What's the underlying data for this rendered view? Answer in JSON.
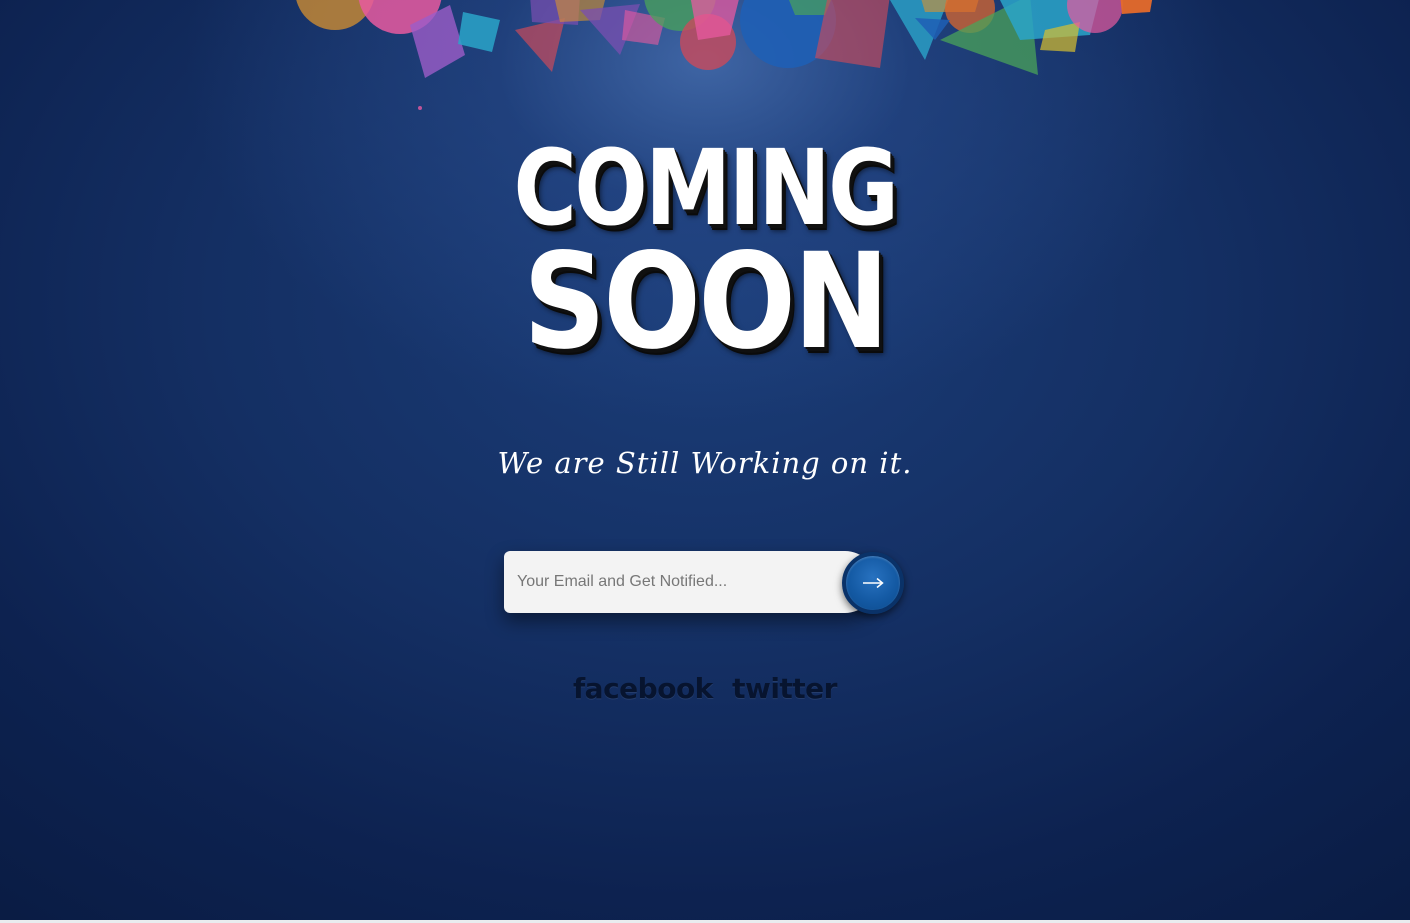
{
  "hero": {
    "title_line1": "COMING",
    "title_line2": "SOON",
    "tagline": "We are Still Working on it."
  },
  "subscribe": {
    "email_placeholder": "Your Email and Get Notified...",
    "email_value": "",
    "submit_icon": "arrow-right-icon"
  },
  "social": {
    "facebook_label": "facebook",
    "twitter_label": "twitter"
  },
  "colors": {
    "background_top": "#1b3d78",
    "background_bottom": "#0a1c44",
    "button_blue": "#145aa4",
    "input_bg": "#f3f3f3",
    "confetti": [
      "#e85aa0",
      "#2aa4c9",
      "#7a4fb0",
      "#4aa35a",
      "#d8922f",
      "#1f5fb5",
      "#e56a2a",
      "#c94a5b",
      "#3a88d6",
      "#9c5cc8",
      "#1aa0a0"
    ]
  }
}
